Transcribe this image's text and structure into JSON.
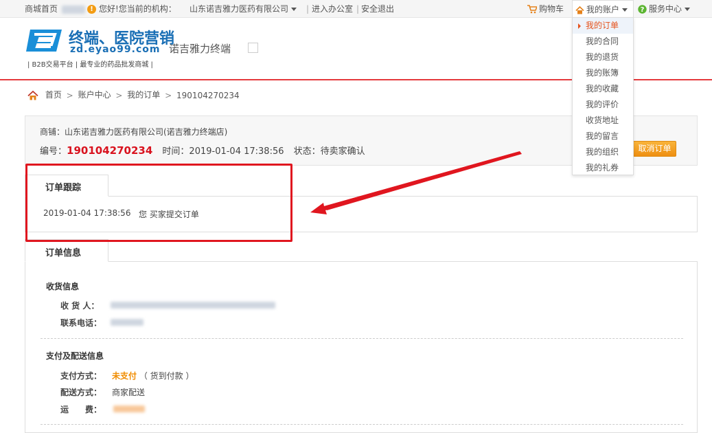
{
  "topbar": {
    "home_link": "商城首页",
    "warning_icon": "!",
    "greeting": "您好!您当前的机构：",
    "org_name": "山东诺吉雅力医药有限公司",
    "sep1": "|",
    "enter_office": "进入办公室",
    "sep2": "|",
    "logout": "安全退出",
    "cart": "购物车",
    "my_account": "我的账户",
    "service_center": "服务中心"
  },
  "account_menu": [
    "我的订单",
    "我的合同",
    "我的退货",
    "我的账簿",
    "我的收藏",
    "我的评价",
    "收货地址",
    "我的留言",
    "我的组织",
    "我的礼券"
  ],
  "header": {
    "logo_title": "终端、医院营销",
    "logo_url": "zd.eyao99.com",
    "logo_slogan": "| B2B交易平台 | 最专业的药品批发商城 |",
    "shop_name": "诺吉雅力终端"
  },
  "breadcrumb": {
    "home": "首页",
    "sep": ">",
    "account_center": "账户中心",
    "my_orders": "我的订单",
    "order_id": "190104270234"
  },
  "order": {
    "shop_line": "商铺：山东诺吉雅力医药有限公司(诺吉雅力终端店)",
    "no_label": "编号：",
    "no_value": "190104270234",
    "time_label": "时间：",
    "time_value": "2019-01-04 17:38:56",
    "status_label": "状态：",
    "status_value": "待卖家确认",
    "cancel_button": "取消订单"
  },
  "tracking": {
    "tab_label": "订单跟踪",
    "time": "2019-01-04 17:38:56",
    "message": "您 买家提交订单"
  },
  "info": {
    "tab_label": "订单信息",
    "receiving_title": "收货信息",
    "receiver_label": "收 货 人：",
    "phone_label": "联系电话：",
    "payment_title": "支付及配送信息",
    "pay_method_label": "支付方式：",
    "pay_status": "未支付",
    "pay_method": "（ 货到付款 ）",
    "delivery_label": "配送方式：",
    "delivery_value": "商家配送",
    "freight_label": "运　　费："
  },
  "colors": {
    "accent_red": "#e4393c",
    "order_no_red": "#d9121e",
    "unpaid_orange": "#f08c00",
    "button_orange": "#ee8f12",
    "brand_blue": "#1a6fb5",
    "annotation_red": "#e0161f"
  }
}
